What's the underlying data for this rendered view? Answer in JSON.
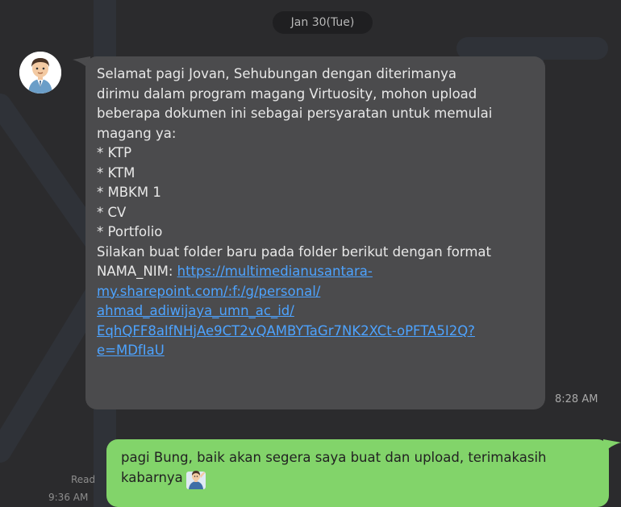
{
  "date_separator": "Jan 30(Tue)",
  "incoming": {
    "text": "Selamat pagi Jovan, Sehubungan dengan diterimanya\ndirimu dalam program magang Virtuosity, mohon upload\nbeberapa dokumen ini sebagai persyaratan untuk memulai\nmagang ya:\n* KTP\n* KTM\n* MBKM 1\n* CV\n* Portfolio\nSilakan buat folder baru pada folder berikut dengan format\nNAMA_NIM: ",
    "link": "https://multimedianusantara-\nmy.sharepoint.com/:f:/g/personal/\nahmad_adiwijaya_umn_ac_id/\nEqhQFF8aIfNHjAe9CT2vQAMBYTaGr7NK2XCt-oPFTA5I2Q?\ne=MDfIaU",
    "time": "8:28 AM"
  },
  "outgoing": {
    "text": "pagi Bung, baik akan segera saya buat dan upload, terimakasih\nkabarnya",
    "read_label": "Read",
    "time": "9:36 AM"
  },
  "colors": {
    "background": "#2b2b2d",
    "incoming_bubble": "#4b4b4d",
    "outgoing_bubble": "#82d46a",
    "link": "#4da3ff"
  }
}
